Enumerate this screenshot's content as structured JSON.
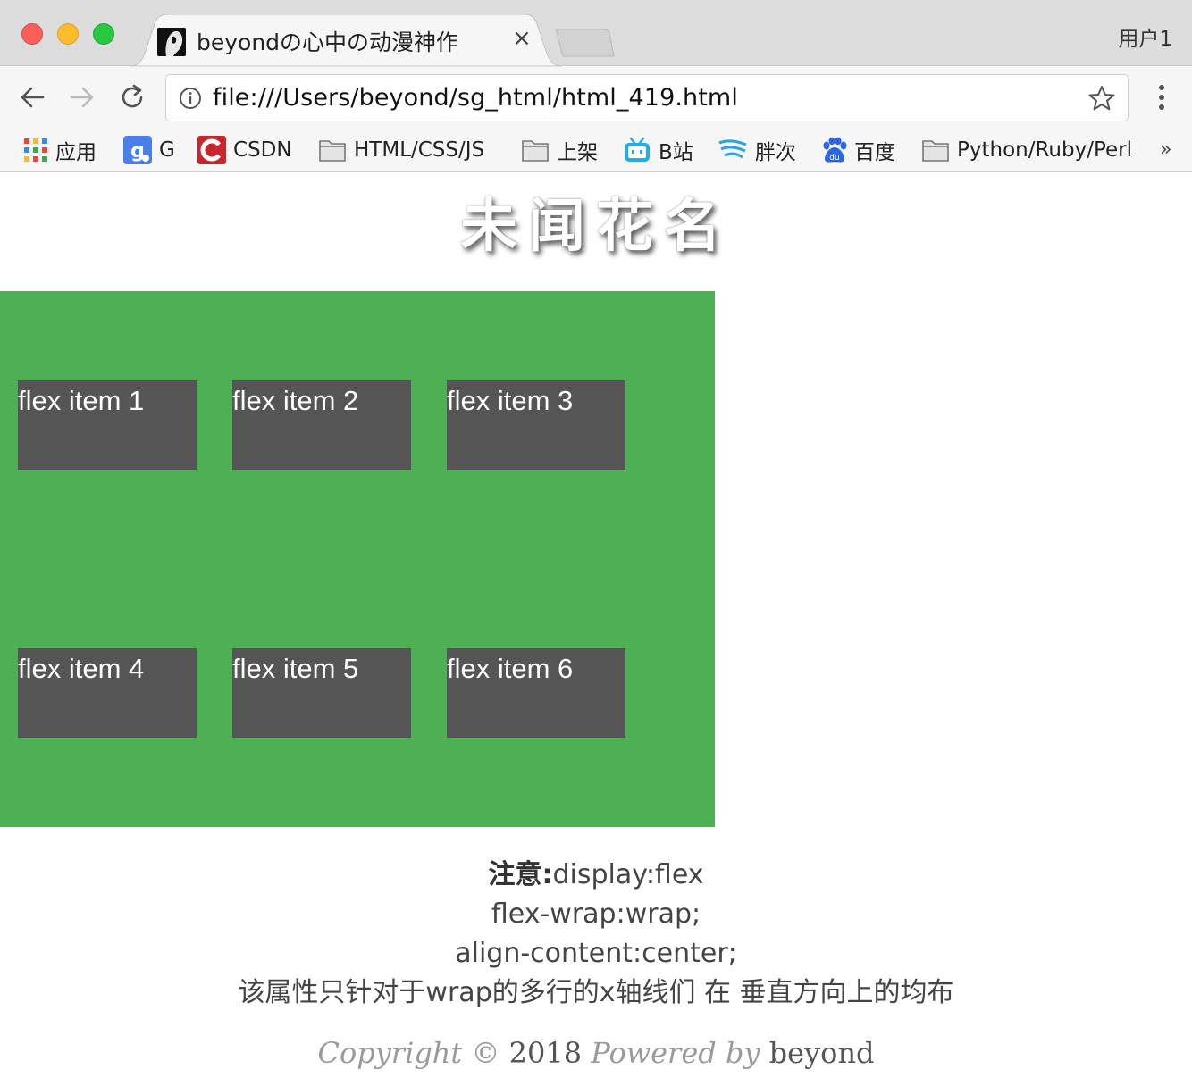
{
  "window": {
    "tab_title": "beyondの心中の动漫神作",
    "tab_close": "×",
    "profile": "用户1"
  },
  "toolbar": {
    "url": "file:///Users/beyond/sg_html/html_419.html"
  },
  "bookmarks": [
    {
      "label": "应用",
      "icon": "apps-grid-icon"
    },
    {
      "label": "G",
      "icon": "google-icon"
    },
    {
      "label": "CSDN",
      "icon": "csdn-icon"
    },
    {
      "label": "HTML/CSS/JS",
      "icon": "folder-icon"
    },
    {
      "label": "上架",
      "icon": "folder-icon"
    },
    {
      "label": "B站",
      "icon": "bilibili-icon"
    },
    {
      "label": "胖次",
      "icon": "wave-icon"
    },
    {
      "label": "百度",
      "icon": "baidu-paw-icon"
    },
    {
      "label": "Python/Ruby/Perl",
      "icon": "folder-icon"
    }
  ],
  "bookmarks_more": "»",
  "page": {
    "title": "未闻花名",
    "flex_items": [
      "flex item 1",
      "flex item 2",
      "flex item 3",
      "flex item 4",
      "flex item 5",
      "flex item 6"
    ],
    "note_label": "注意:",
    "note_lines": [
      "display:flex",
      "flex-wrap:wrap;",
      "align-content:center;",
      "该属性只针对于wrap的多行的x轴线们 在 垂直方向上的均布"
    ],
    "copyright": {
      "prefix": "Copyright ©",
      "year": "2018",
      "powered": "Powered by",
      "author": "beyond"
    }
  },
  "colors": {
    "container_green": "#4faf55",
    "item_gray": "#555555"
  }
}
